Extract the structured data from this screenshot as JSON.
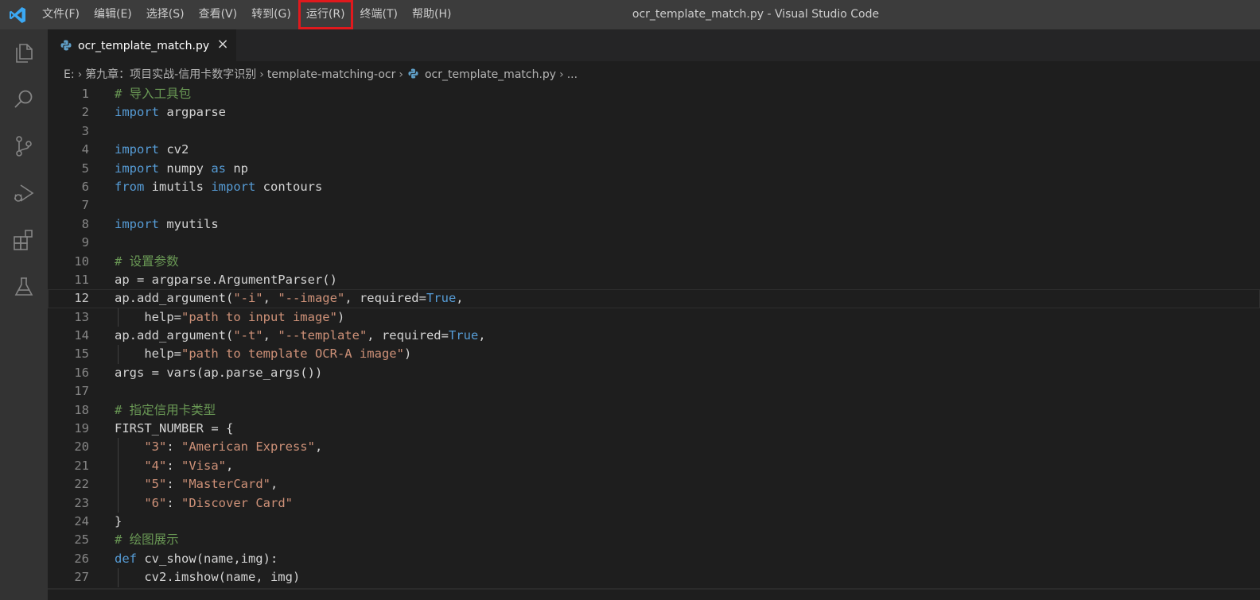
{
  "menu": [
    {
      "label": "文件(F)",
      "highlighted": false
    },
    {
      "label": "编辑(E)",
      "highlighted": false
    },
    {
      "label": "选择(S)",
      "highlighted": false
    },
    {
      "label": "查看(V)",
      "highlighted": false
    },
    {
      "label": "转到(G)",
      "highlighted": false
    },
    {
      "label": "运行(R)",
      "highlighted": true
    },
    {
      "label": "终端(T)",
      "highlighted": false
    },
    {
      "label": "帮助(H)",
      "highlighted": false
    }
  ],
  "window_title": "ocr_template_match.py - Visual Studio Code",
  "activity_icons": [
    "explorer-icon",
    "search-icon",
    "source-control-icon",
    "run-debug-icon",
    "extensions-icon",
    "testing-icon"
  ],
  "tab": {
    "label": "ocr_template_match.py",
    "icon": "python-icon",
    "close": "×"
  },
  "breadcrumb": [
    "E:",
    "第九章：项目实战-信用卡数字识别",
    "template-matching-ocr",
    "ocr_template_match.py",
    "..."
  ],
  "editor": {
    "current_line": 12,
    "lines": [
      {
        "n": "1",
        "indent": false,
        "tokens": [
          {
            "t": "# 导入工具包",
            "c": "cm"
          }
        ]
      },
      {
        "n": "2",
        "indent": false,
        "tokens": [
          {
            "t": "import",
            "c": "kw"
          },
          {
            "t": " argparse",
            "c": ""
          }
        ]
      },
      {
        "n": "3",
        "indent": false,
        "tokens": []
      },
      {
        "n": "4",
        "indent": false,
        "tokens": [
          {
            "t": "import",
            "c": "kw"
          },
          {
            "t": " cv2",
            "c": ""
          }
        ]
      },
      {
        "n": "5",
        "indent": false,
        "tokens": [
          {
            "t": "import",
            "c": "kw"
          },
          {
            "t": " numpy ",
            "c": ""
          },
          {
            "t": "as",
            "c": "kw"
          },
          {
            "t": " np",
            "c": ""
          }
        ]
      },
      {
        "n": "6",
        "indent": false,
        "tokens": [
          {
            "t": "from",
            "c": "kw"
          },
          {
            "t": " imutils ",
            "c": ""
          },
          {
            "t": "import",
            "c": "kw"
          },
          {
            "t": " contours",
            "c": ""
          }
        ]
      },
      {
        "n": "7",
        "indent": false,
        "tokens": []
      },
      {
        "n": "8",
        "indent": false,
        "tokens": [
          {
            "t": "import",
            "c": "kw"
          },
          {
            "t": " myutils",
            "c": ""
          }
        ]
      },
      {
        "n": "9",
        "indent": false,
        "tokens": []
      },
      {
        "n": "10",
        "indent": false,
        "tokens": [
          {
            "t": "# 设置参数",
            "c": "cm"
          }
        ]
      },
      {
        "n": "11",
        "indent": false,
        "tokens": [
          {
            "t": "ap = argparse.ArgumentParser()",
            "c": ""
          }
        ]
      },
      {
        "n": "12",
        "indent": false,
        "tokens": [
          {
            "t": "ap.add_argument(",
            "c": ""
          },
          {
            "t": "\"-i\"",
            "c": "str"
          },
          {
            "t": ", ",
            "c": ""
          },
          {
            "t": "\"--image\"",
            "c": "str"
          },
          {
            "t": ", required=",
            "c": ""
          },
          {
            "t": "True",
            "c": "kw"
          },
          {
            "t": ",",
            "c": ""
          }
        ]
      },
      {
        "n": "13",
        "indent": true,
        "tokens": [
          {
            "t": "    help=",
            "c": ""
          },
          {
            "t": "\"path to input image\"",
            "c": "str"
          },
          {
            "t": ")",
            "c": ""
          }
        ]
      },
      {
        "n": "14",
        "indent": false,
        "tokens": [
          {
            "t": "ap.add_argument(",
            "c": ""
          },
          {
            "t": "\"-t\"",
            "c": "str"
          },
          {
            "t": ", ",
            "c": ""
          },
          {
            "t": "\"--template\"",
            "c": "str"
          },
          {
            "t": ", required=",
            "c": ""
          },
          {
            "t": "True",
            "c": "kw"
          },
          {
            "t": ",",
            "c": ""
          }
        ]
      },
      {
        "n": "15",
        "indent": true,
        "tokens": [
          {
            "t": "    help=",
            "c": ""
          },
          {
            "t": "\"path to template OCR-A image\"",
            "c": "str"
          },
          {
            "t": ")",
            "c": ""
          }
        ]
      },
      {
        "n": "16",
        "indent": false,
        "tokens": [
          {
            "t": "args = vars(ap.parse_args())",
            "c": ""
          }
        ]
      },
      {
        "n": "17",
        "indent": false,
        "tokens": []
      },
      {
        "n": "18",
        "indent": false,
        "tokens": [
          {
            "t": "# 指定信用卡类型",
            "c": "cm"
          }
        ]
      },
      {
        "n": "19",
        "indent": false,
        "tokens": [
          {
            "t": "FIRST_NUMBER = {",
            "c": ""
          }
        ]
      },
      {
        "n": "20",
        "indent": true,
        "tokens": [
          {
            "t": "    ",
            "c": ""
          },
          {
            "t": "\"3\"",
            "c": "str"
          },
          {
            "t": ": ",
            "c": ""
          },
          {
            "t": "\"American Express\"",
            "c": "str"
          },
          {
            "t": ",",
            "c": ""
          }
        ]
      },
      {
        "n": "21",
        "indent": true,
        "tokens": [
          {
            "t": "    ",
            "c": ""
          },
          {
            "t": "\"4\"",
            "c": "str"
          },
          {
            "t": ": ",
            "c": ""
          },
          {
            "t": "\"Visa\"",
            "c": "str"
          },
          {
            "t": ",",
            "c": ""
          }
        ]
      },
      {
        "n": "22",
        "indent": true,
        "tokens": [
          {
            "t": "    ",
            "c": ""
          },
          {
            "t": "\"5\"",
            "c": "str"
          },
          {
            "t": ": ",
            "c": ""
          },
          {
            "t": "\"MasterCard\"",
            "c": "str"
          },
          {
            "t": ",",
            "c": ""
          }
        ]
      },
      {
        "n": "23",
        "indent": true,
        "tokens": [
          {
            "t": "    ",
            "c": ""
          },
          {
            "t": "\"6\"",
            "c": "str"
          },
          {
            "t": ": ",
            "c": ""
          },
          {
            "t": "\"Discover Card\"",
            "c": "str"
          }
        ]
      },
      {
        "n": "24",
        "indent": false,
        "tokens": [
          {
            "t": "}",
            "c": ""
          }
        ]
      },
      {
        "n": "25",
        "indent": false,
        "tokens": [
          {
            "t": "# 绘图展示",
            "c": "cm"
          }
        ]
      },
      {
        "n": "26",
        "indent": false,
        "tokens": [
          {
            "t": "def",
            "c": "kw"
          },
          {
            "t": " cv_show(name,img):",
            "c": ""
          }
        ]
      },
      {
        "n": "27",
        "indent": true,
        "tokens": [
          {
            "t": "    cv2.imshow(name, img)",
            "c": ""
          }
        ]
      }
    ]
  },
  "colors": {
    "accent_highlight": "#e0191d",
    "keyword": "#569cd6",
    "string": "#ce9178",
    "comment": "#6a9955",
    "editor_bg": "#1e1e1e"
  }
}
